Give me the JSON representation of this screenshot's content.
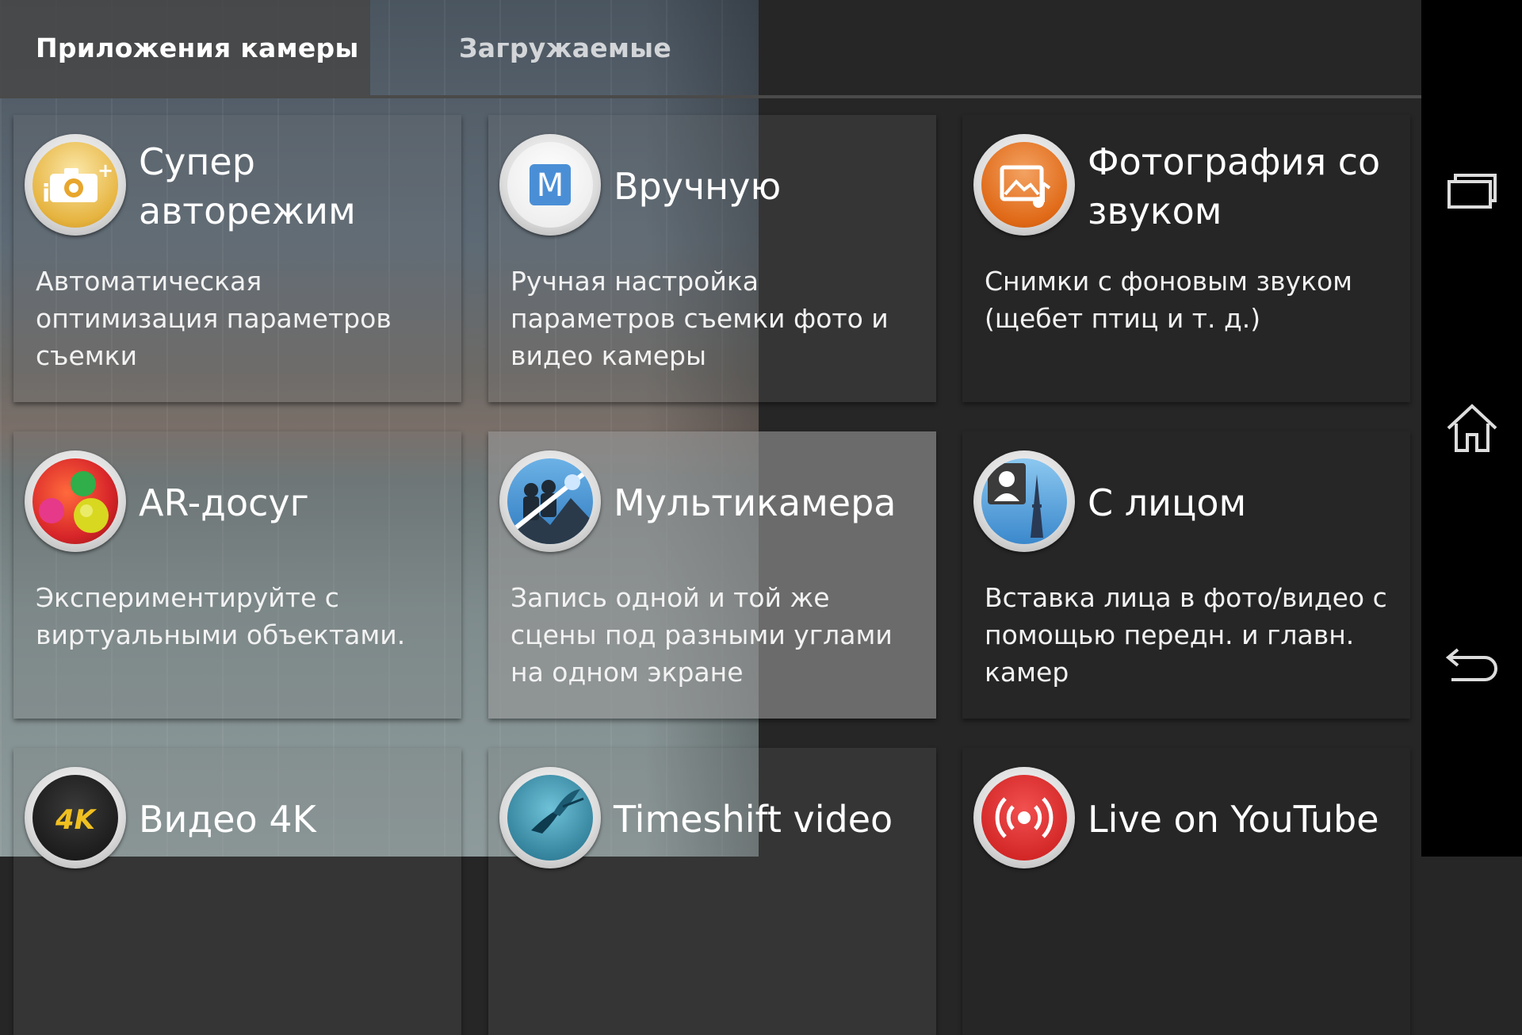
{
  "tabs": [
    {
      "label": "Приложения камеры",
      "active": true
    },
    {
      "label": "Загружаемые",
      "active": false
    }
  ],
  "apps": [
    {
      "title": "Супер авторежим",
      "description": "Автоматическая оптимизация параметров съемки",
      "icon": "superior-auto-icon"
    },
    {
      "title": "Вручную",
      "description": "Ручная настройка параметров съемки фото и видео камеры",
      "icon": "manual-mode-icon"
    },
    {
      "title": "Фотография со звуком",
      "description": "Снимки с фоновым звуком (щебет птиц и т. д.)",
      "icon": "sound-photo-icon"
    },
    {
      "title": "AR-досуг",
      "description": "Экспериментируйте с виртуальными объектами.",
      "icon": "ar-fun-icon"
    },
    {
      "title": "Мультикамера",
      "description": "Запись одной и той же сцены под разными углами на одном экране",
      "icon": "multi-camera-icon"
    },
    {
      "title": "С лицом",
      "description": "Вставка лица в фото/видео с помощью передн. и главн. камер",
      "icon": "face-in-picture-icon"
    },
    {
      "title": "Видео 4K",
      "description": "",
      "icon": "video-4k-icon"
    },
    {
      "title": "Timeshift video",
      "description": "",
      "icon": "timeshift-video-icon"
    },
    {
      "title": "Live on YouTube",
      "description": "",
      "icon": "live-youtube-icon"
    }
  ],
  "icon_labels": {
    "manual": "M",
    "k4": "4K"
  },
  "navbar": {
    "buttons": [
      "recent-apps-icon",
      "home-icon",
      "back-icon"
    ]
  }
}
